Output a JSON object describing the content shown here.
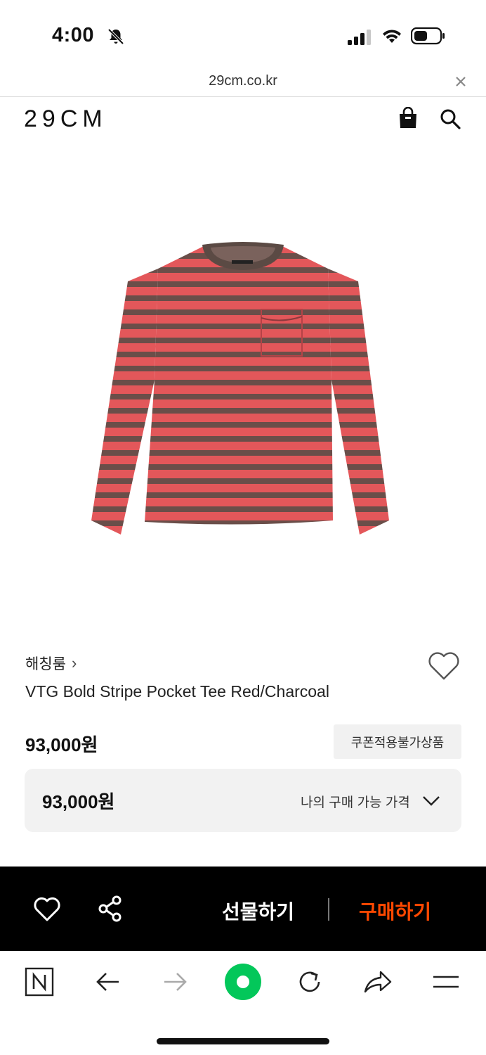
{
  "status_bar": {
    "time": "4:00",
    "icons": [
      "bell-slash-icon",
      "signal-icon",
      "wifi-icon",
      "battery-icon"
    ]
  },
  "browser": {
    "url": "29cm.co.kr",
    "close_icon": "close-icon"
  },
  "header": {
    "logo": "29CM",
    "icons": [
      "shopping-bag-icon",
      "search-icon"
    ]
  },
  "product": {
    "image_desc_icon": "striped-long-sleeve-tee-image",
    "brand": "해칭룸",
    "brand_chevron": "›",
    "title": "VTG Bold Stripe Pocket Tee Red/Charcoal",
    "price": "93,000원",
    "coupon_label": "쿠폰적용불가상품",
    "my_price": {
      "value": "93,000원",
      "label": "나의 구매 가능 가격"
    }
  },
  "action_bar": {
    "gift_label": "선물하기",
    "buy_label": "구매하기",
    "buy_color": "#ff4800",
    "background": "#000000"
  },
  "browser_toolbar": {
    "items": [
      "naver-n-icon",
      "back-arrow-icon",
      "forward-arrow-icon",
      "green-home-icon",
      "reload-icon",
      "share-arrow-icon",
      "menu-icon"
    ],
    "accent": "#03c75a"
  },
  "colors": {
    "shirt_red": "#e3575a",
    "shirt_charcoal": "#5b4a44"
  }
}
